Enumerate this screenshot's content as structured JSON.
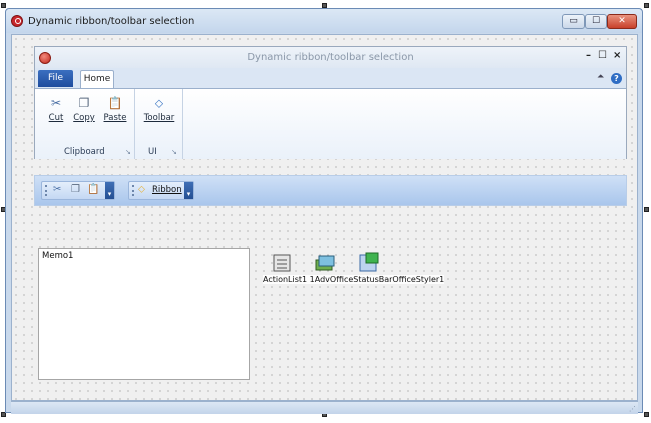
{
  "outer_window": {
    "title": "Dynamic ribbon/toolbar selection",
    "min_glyph": "▭",
    "max_glyph": "☐",
    "close_glyph": "✕"
  },
  "inner_form": {
    "title": "Dynamic ribbon/toolbar selection",
    "minimize_glyph": "–",
    "maximize_glyph": "☐",
    "close_glyph": "×",
    "tabs": {
      "file_label": "File",
      "home_label": "Home"
    },
    "collapse_glyph": "⏶",
    "help_glyph": "?",
    "groups": {
      "clipboard": {
        "label": "Clipboard",
        "cut_label": "Cut",
        "copy_label": "Copy",
        "paste_label": "Paste"
      },
      "ui": {
        "label": "UI",
        "toolbar_label": "Toolbar"
      }
    },
    "launcher_glyph": "↘"
  },
  "toolbar_strip": {
    "clipboard_toolbar_glyphs": [
      "✂",
      "❐",
      "📋"
    ],
    "ribbon_button_label": "Ribbon",
    "chevron_glyph": "▾"
  },
  "memo": {
    "text": "Memo1"
  },
  "components": {
    "labels_text": "ActionList1 1AdvOfficeStatusBarOfficeStyler1"
  },
  "colors": {
    "accent_blue": "#1f4d9e",
    "ribbon_bar": "#a9c6ec",
    "close_red": "#c8402a"
  }
}
